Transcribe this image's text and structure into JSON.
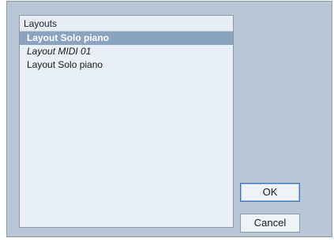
{
  "layouts_panel": {
    "header": "Layouts",
    "items": [
      {
        "label": "Layout Solo piano",
        "selected": true,
        "italic": false
      },
      {
        "label": "Layout MIDI 01",
        "selected": false,
        "italic": true
      },
      {
        "label": "Layout Solo piano",
        "selected": false,
        "italic": false
      }
    ]
  },
  "buttons": {
    "ok_label": "OK",
    "cancel_label": "Cancel"
  },
  "colors": {
    "dialog_background": "#b8c6d5",
    "selection": "#8aa3c0",
    "list_background": "#e9eff6"
  }
}
